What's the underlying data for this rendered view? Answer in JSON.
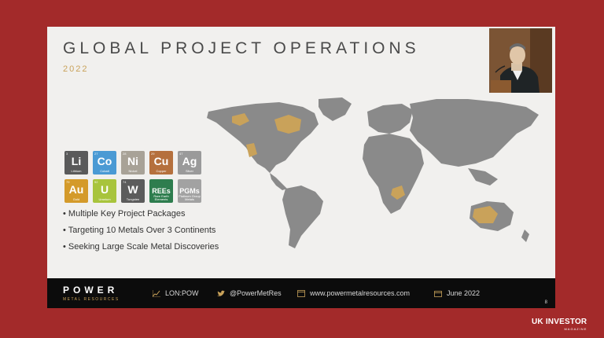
{
  "slide": {
    "title": "GLOBAL PROJECT OPERATIONS",
    "year": "2022",
    "elements": [
      {
        "num": "3",
        "sym": "Li",
        "name": "Lithium",
        "color": "#5a5a5a"
      },
      {
        "num": "27",
        "sym": "Co",
        "name": "Cobalt",
        "color": "#4a9ad4"
      },
      {
        "num": "28",
        "sym": "Ni",
        "name": "Nickel",
        "color": "#a8a297"
      },
      {
        "num": "29",
        "sym": "Cu",
        "name": "Copper",
        "color": "#b5703d"
      },
      {
        "num": "47",
        "sym": "Ag",
        "name": "Silver",
        "color": "#9a9a9a"
      },
      {
        "num": "79",
        "sym": "Au",
        "name": "Gold",
        "color": "#d49a2a"
      },
      {
        "num": "92",
        "sym": "U",
        "name": "Uranium",
        "color": "#a8c43c"
      },
      {
        "num": "74",
        "sym": "W",
        "name": "Tungsten",
        "color": "#5c5c5c"
      },
      {
        "num": "",
        "sym": "REEs",
        "name": "Rare Earth Elements",
        "color": "#2e7d4e"
      },
      {
        "num": "",
        "sym": "PGMs",
        "name": "Platinum Group Metals",
        "color": "#a2a2a2"
      }
    ],
    "bullets": [
      "• Multiple Key Project Packages",
      "• Targeting 10 Metals Over 3 Continents",
      "• Seeking Large Scale Metal Discoveries"
    ],
    "footer": {
      "logo_main": "POWER",
      "logo_sub": "METAL RESOURCES",
      "ticker": "LON:POW",
      "twitter": "@PowerMetRes",
      "website": "www.powermetalresources.com",
      "date": "June 2022",
      "page": "8"
    }
  },
  "brand": {
    "main": "UK INVESTOR",
    "sub": "MAGAZINE"
  },
  "colors": {
    "background": "#a32a2a",
    "map_land": "#8a8a8a",
    "map_highlight": "#c9a25a",
    "footer": "#0c0c0c"
  }
}
